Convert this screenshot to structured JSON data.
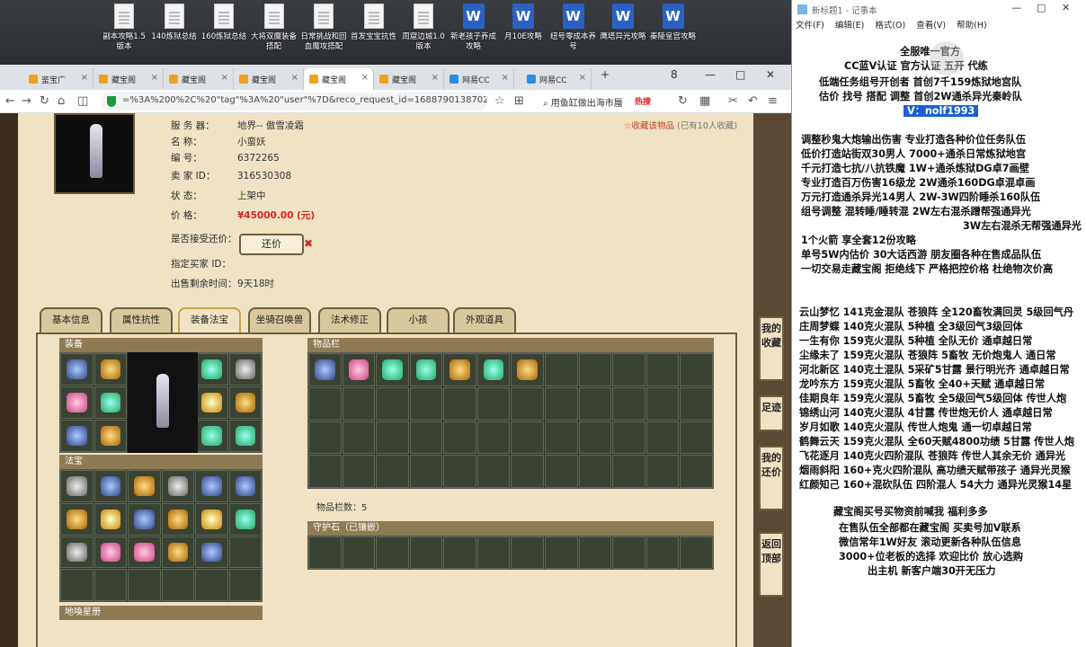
{
  "desktop": {
    "icons": [
      {
        "label": "副本攻略1.5版本",
        "kind": "doc"
      },
      {
        "label": "140炼狱总结",
        "kind": "doc"
      },
      {
        "label": "160炼狱总结",
        "kind": "doc"
      },
      {
        "label": "大将双魔装备搭配",
        "kind": "doc"
      },
      {
        "label": "日常挑战和回血魔攻搭配",
        "kind": "doc"
      },
      {
        "label": "首发宝宝抗性",
        "kind": "doc"
      },
      {
        "label": "周窟边城1.0版本",
        "kind": "doc"
      },
      {
        "label": "新老孩子养成攻略",
        "kind": "word"
      },
      {
        "label": "月10E攻略",
        "kind": "word"
      },
      {
        "label": "纽号零成本养号",
        "kind": "word"
      },
      {
        "label": "鹰塔异光攻略",
        "kind": "word"
      },
      {
        "label": "秦陵皇宫攻略",
        "kind": "word"
      }
    ]
  },
  "browser": {
    "tabs": [
      "鉴宝广",
      "藏宝阁",
      "藏宝阁",
      "藏宝阁",
      "藏宝阁",
      "藏宝阁",
      "网易CC",
      "网易CC"
    ],
    "window_controls": [
      "8",
      "—",
      "□",
      "✕"
    ],
    "url": "=%3A%200%2C%20\"tag\"%3A%20\"user\"%7D&reco_request_id=1688790138702rJc0r",
    "search_text": "用鱼缸做出海市蜃",
    "hot_label": "热搜"
  },
  "listing": {
    "fav_link": "收藏该物品",
    "fav_count": "(已有10人收藏)",
    "rows": [
      {
        "k": "服 务 器：",
        "v": "地界-- 傲雪凌霜"
      },
      {
        "k": "名      称：",
        "v": "小蛮妖"
      },
      {
        "k": "编      号：",
        "v": "6372265"
      },
      {
        "k": "卖  家  ID：",
        "v": "316530308"
      },
      {
        "k": "状      态：",
        "v": "上架中"
      },
      {
        "k": "价      格：",
        "v": "¥45000.00 (元)"
      },
      {
        "k": "是否接受还价：",
        "v": ""
      },
      {
        "k": "指定买家 ID：",
        "v": ""
      },
      {
        "k": "出售剩余时间：",
        "v": "9天18时"
      }
    ],
    "haggle_button": "还价",
    "tabs": [
      "基本信息",
      "属性抗性",
      "装备法宝",
      "坐骑召唤兽",
      "法术修正",
      "小孩",
      "外观道具"
    ],
    "active_tab": "装备法宝",
    "sections": {
      "equip": "装备",
      "treasure": "法宝",
      "inventory": "物品栏",
      "guard": "守护石（已镶嵌）",
      "tianwei": "地喚星册"
    },
    "item_count": "物品栏数：5",
    "side_buttons": [
      "我的收藏",
      "足迹",
      "我的还价",
      "返回顶部"
    ]
  },
  "notepad": {
    "title": "新标题1 - 记事本",
    "menu": [
      "文件(F)",
      "编辑(E)",
      "格式(O)",
      "查看(V)",
      "帮助(H)"
    ],
    "lines": [
      "全服唯一官方",
      "CC蓝V认证  官方认证 五开 代练",
      "低端任务组号开创者              首创7千159炼狱地宫队",
      "估价  找号  搭配  调整         首创2W通杀异光秦岭队",
      "V：nolf1993",
      "调整秒鬼大炮输出伤害          专业打造各种价位任务队伍",
      "低价打造站街双30男人           7000+通杀日常炼狱地宫",
      "千元打造七抗/八抗铁魔          1W+通杀炼狱DG卓7画壁",
      "专业打造百万伤害16级龙        2W通杀160DG卓混卓画",
      "万元打造通杀异光14男人      2W-3W四阶睡杀160队伍",
      "组号调整  混转睡/睡转混        2W左右混杀蹭帮强通异光",
      "3W左右混杀无帮强通异光",
      "1个火箭  享全套12份攻略",
      "单号5W内估价  30大话西游         朋友圈各种在售成品队伍",
      "一切交易走藏宝阁  拒绝线下      严格把控价格  杜绝物次价高",
      "云山梦忆  141克金混队  苍狼阵  全120畜牧满回灵  5级回气丹",
      "庄周梦蝶  140克火混队  5种植  全3级回气3级回体",
      "一生有你  159克火混队  5种植  全队无价  通卓越日常",
      "尘缘未了  159克火混队  苍狼阵  5畜牧  无价炮鬼人  通日常",
      "河北新区  140克土混队  5采矿5甘露  景行明光齐  通卓越日常",
      "龙吟东方  159克火混队  5畜牧  全40+天赋  通卓越日常",
      "佳期良年  159克火混队  5畜牧  全5级回气5级回体  传世人炮",
      "锦绣山河  140克火混队  4甘露  传世炮无价人  通卓越日常",
      "岁月如歌  140克火混队  传世人炮鬼  通一切卓越日常",
      "鹤舞云天  159克火混队  全60天赋4800功绩  5甘露  传世人炮",
      "飞花逐月  140克火四阶混队  苍狼阵  传世人其余无价  通异光",
      "烟雨斜阳  160+克火四阶混队  高功绩天赋带孩子  通异光灵猴",
      "红颜知己  160+混砍队伍  四阶混人  54大力  通异光灵猴14星",
      "藏宝阁买号买物资前喊我  福利多多",
      "在售队伍全部都在藏宝阁  买卖号加V联系",
      "微信常年1W好友  滚动更新各种队伍信息",
      "3000+位老板的选择  欢迎比价  放心选购",
      "出主机  新客户端30开无压力"
    ]
  },
  "colors": {
    "price": "#dd2222",
    "panel_bg": "#efe3c4",
    "border": "#6d5f3a",
    "highlight": "#1c5fd4"
  }
}
